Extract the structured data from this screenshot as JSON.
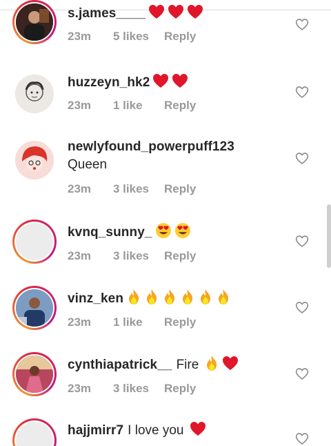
{
  "comments": [
    {
      "username": "s.james____",
      "text": "",
      "emoji": [
        "red-heart",
        "red-heart",
        "red-heart"
      ],
      "time": "23m",
      "likes": "5 likes",
      "reply": "Reply",
      "ring": true,
      "avatar": "photo-person-dark"
    },
    {
      "username": "huzzeyn_hk2",
      "text": "",
      "emoji": [
        "red-heart",
        "red-heart"
      ],
      "time": "23m",
      "likes": "1 like",
      "reply": "Reply",
      "ring": false,
      "avatar": "sketch-portrait"
    },
    {
      "username": "newlyfound_powerpuff123",
      "text": "",
      "second_line": "Queen",
      "emoji": [],
      "time": "23m",
      "likes": "3 likes",
      "reply": "Reply",
      "ring": false,
      "avatar": "cartoon-redhead"
    },
    {
      "username": "kvnq_sunny_",
      "text": "",
      "emoji": [
        "heart-eyes",
        "heart-eyes"
      ],
      "time": "23m",
      "likes": "3 likes",
      "reply": "Reply",
      "ring": true,
      "avatar": "placeholder"
    },
    {
      "username": "vinz_ken",
      "text": "",
      "emoji": [
        "fire",
        "fire",
        "fire",
        "fire",
        "fire",
        "fire"
      ],
      "time": "23m",
      "likes": "1 like",
      "reply": "Reply",
      "ring": true,
      "avatar": "photo-man-blue"
    },
    {
      "username": "cynthiapatrick__",
      "text": "Fire",
      "emoji": [
        "fire",
        "red-heart"
      ],
      "time": "23m",
      "likes": "3 likes",
      "reply": "Reply",
      "ring": true,
      "avatar": "photo-woman-pink"
    },
    {
      "username": "hajjmirr7",
      "text": "I love you",
      "emoji": [
        "red-heart"
      ],
      "time": "",
      "likes": "",
      "reply": "",
      "ring": true,
      "avatar": "placeholder"
    }
  ],
  "icons": {
    "like": "heart-outline-icon",
    "red-heart": "❤",
    "heart-eyes": "😍",
    "fire": "🔥"
  },
  "colors": {
    "text": "#262626",
    "meta": "#999999",
    "heart_red": "#e0162b",
    "ring_start": "#f09433",
    "ring_end": "#bc1888"
  }
}
